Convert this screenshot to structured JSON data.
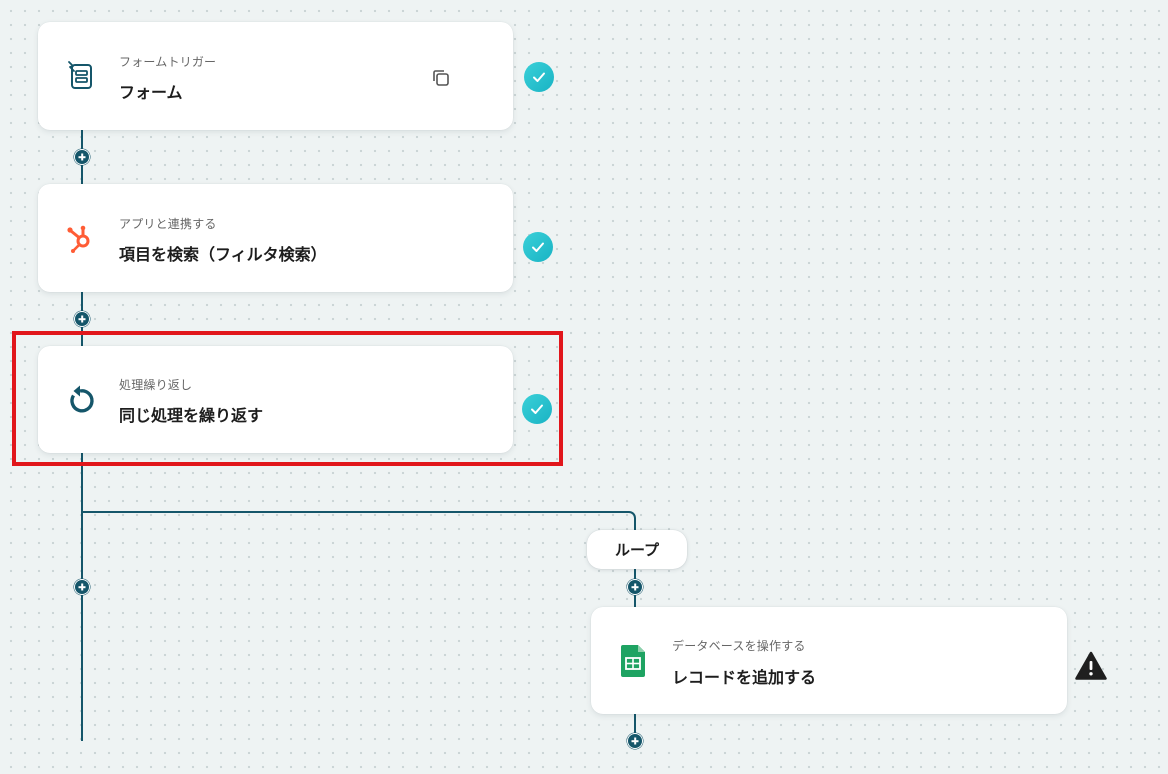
{
  "steps": [
    {
      "category": "フォームトリガー",
      "title": "フォーム",
      "icon": "form-trigger-icon"
    },
    {
      "category": "アプリと連携する",
      "title": "項目を検索（フィルタ検索）",
      "icon": "hubspot-icon"
    },
    {
      "category": "処理繰り返し",
      "title": "同じ処理を繰り返す",
      "icon": "repeat-icon"
    }
  ],
  "loop": {
    "label": "ループ",
    "step": {
      "category": "データベースを操作する",
      "title": "レコードを追加する",
      "icon": "google-sheets-icon"
    }
  },
  "colors": {
    "connector": "#15566a",
    "check": "#19b3c4",
    "highlight": "#e1161b",
    "hubspot": "#ff5c35",
    "sheets": "#1ea362",
    "warning": "#1f1f1f"
  }
}
